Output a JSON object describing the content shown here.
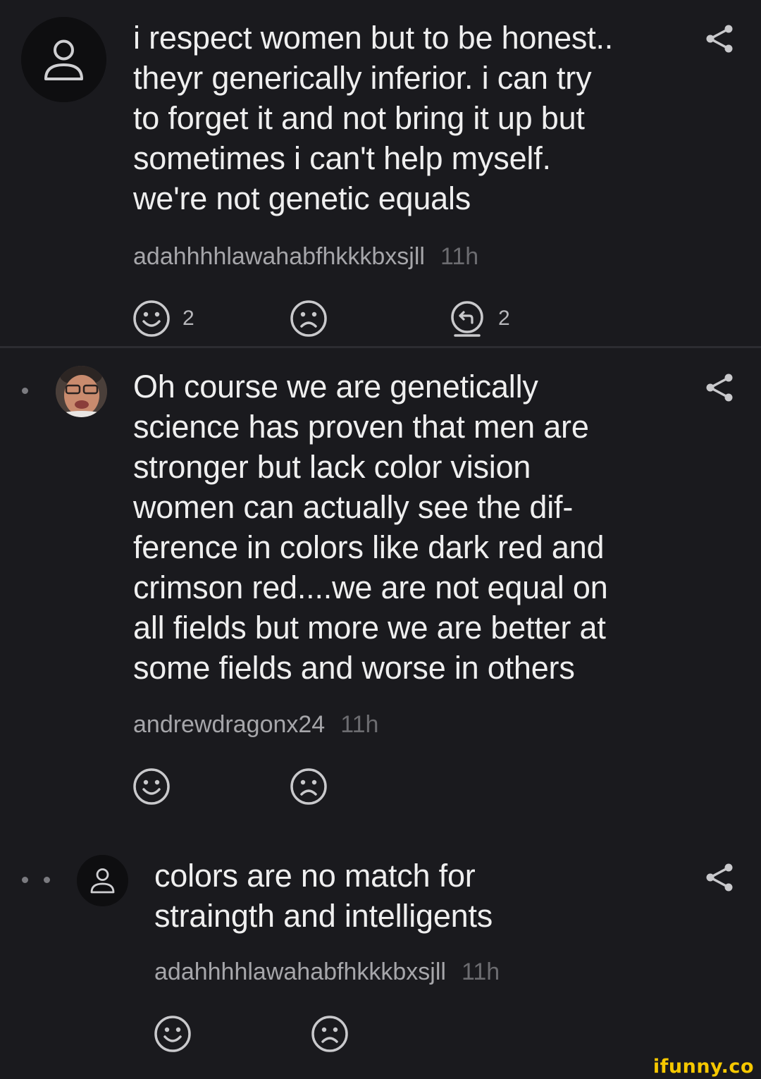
{
  "comments": [
    {
      "avatar": "default-user-icon",
      "lines": [
        "i respect women but to be honest..",
        "theyr generically inferior. i can try",
        "to forget it and not bring it up but",
        "sometimes i can't help myself.",
        "we're not genetic equals"
      ],
      "username": "adahhhhlawahabfhkkkbxsjll",
      "time": "11h",
      "smile_count": "2",
      "reply_count": "2"
    },
    {
      "avatar": "user-photo",
      "lines": [
        "Oh course we are genetically",
        "science has proven that men are",
        "stronger but lack color vision",
        "women can actually see the dif-",
        "ference in colors like dark red and",
        "crimson red....we are not equal on",
        "all fields but more we are better at",
        "some fields and worse in others"
      ],
      "username": "andrewdragonx24",
      "time": "11h"
    },
    {
      "avatar": "default-user-icon",
      "lines": [
        "colors are no match for",
        "straingth and intelligents"
      ],
      "username": "adahhhhlawahabfhkkkbxsjll",
      "time": "11h"
    }
  ],
  "icons": {
    "share": "share-icon",
    "smile": "smile-icon",
    "unsmile": "unsmile-icon",
    "reply": "reply-icon"
  },
  "colors": {
    "background": "#1a1a1e",
    "text": "#efefef",
    "username": "#a6a6aa",
    "time": "#6c6c70",
    "icon": "#c9c9cc",
    "watermark": "#f6c800"
  },
  "watermark": "ifunny.co"
}
